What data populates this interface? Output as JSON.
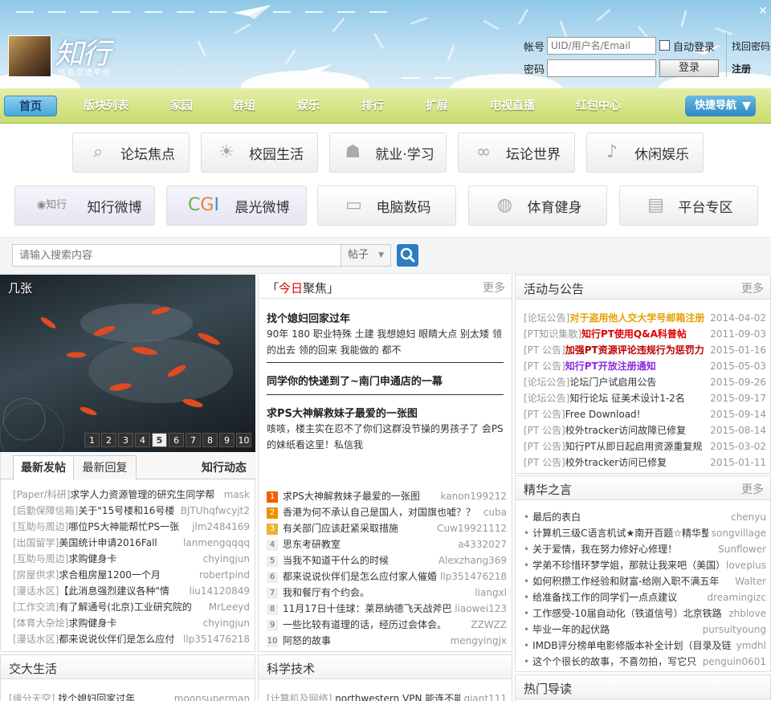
{
  "header": {
    "logo_brand": "知行",
    "logo_sub": "信息交流平台",
    "close_icon": "close-icon"
  },
  "login": {
    "account_label": "帐号",
    "account_placeholder": "UID/用户名/Email",
    "auto_login_label": "自动登录",
    "find_password": "找回密码",
    "password_label": "密码",
    "login_button": "登录",
    "register": "注册"
  },
  "nav": {
    "items": [
      "首页",
      "版块列表",
      "家园",
      "群组",
      "娱乐",
      "排行",
      "扩展",
      "电视直播",
      "红包中心"
    ],
    "quick_nav": "快捷导航"
  },
  "categories": {
    "row1": [
      {
        "label": "论坛焦点",
        "icon": "search-icon"
      },
      {
        "label": "校园生活",
        "icon": "bulb-icon"
      },
      {
        "label": "就业·学习",
        "icon": "people-icon"
      },
      {
        "label": "坛论世界",
        "icon": "binoculars-icon"
      },
      {
        "label": "休闲娱乐",
        "icon": "guitar-icon"
      }
    ],
    "row2": [
      {
        "label": "知行微博",
        "icon": "zhixing-logo-icon"
      },
      {
        "label": "晨光微博",
        "icon": "chenguang-logo-icon"
      },
      {
        "label": "电脑数码",
        "icon": "monitor-icon"
      },
      {
        "label": "体育健身",
        "icon": "ball-icon"
      },
      {
        "label": "平台专区",
        "icon": "board-icon"
      }
    ]
  },
  "search": {
    "placeholder": "请输入搜索内容",
    "type": "帖子"
  },
  "slideshow": {
    "title": "几张",
    "pages": [
      "1",
      "2",
      "3",
      "4",
      "5",
      "6",
      "7",
      "8",
      "9",
      "10"
    ],
    "active_page": "5"
  },
  "focus": {
    "title_prefix": "「",
    "title_red": "今日",
    "title_rest": "聚焦」",
    "more": "更多",
    "articles": [
      {
        "title": "找个媳妇回家过年",
        "summary": "90年 180 职业特殊 土建 我想媳妇 眼睛大点 别太矮 领的出去 领的回来 我能做的 都不"
      },
      {
        "title": "同学你的快递到了~南门申通店的一幕",
        "summary": ""
      },
      {
        "title": "求PS大神解救妹子最爱的一张图",
        "summary": "咳咳，楼主实在忍不了你们这群没节操的男孩子了 会PS的妹纸看这里！私信我"
      }
    ]
  },
  "activity": {
    "title": "活动与公告",
    "more": "更多",
    "items": [
      {
        "tag": "[论坛公告]",
        "text": "对于盗用他人交大学号邮箱注册",
        "date": "2014-04-02",
        "color": "#e8a000",
        "bold": true
      },
      {
        "tag": "[PT知识集散]",
        "text": "知行PT使用Q&A科普帖",
        "date": "2011-09-03",
        "color": "#e00000",
        "bold": true
      },
      {
        "tag": "[PT 公告]",
        "text": "加强PT资源评论违规行为惩罚力",
        "date": "2015-01-16",
        "color": "#c00000",
        "bold": true
      },
      {
        "tag": "[PT 公告]",
        "text": "知行PT开放注册通知",
        "date": "2015-05-03",
        "color": "#8a2be2",
        "bold": true
      },
      {
        "tag": "[论坛公告]",
        "text": "论坛门户试启用公告",
        "date": "2015-09-26",
        "color": "#333",
        "bold": false
      },
      {
        "tag": "[论坛公告]",
        "text": "知行论坛 征美术设计1-2名",
        "date": "2015-09-17",
        "color": "#333",
        "bold": false
      },
      {
        "tag": "[PT 公告]",
        "text": "Free Download!",
        "date": "2015-09-14",
        "color": "#333",
        "bold": false
      },
      {
        "tag": "[PT 公告]",
        "text": "校外tracker访问故障已修复",
        "date": "2015-08-14",
        "color": "#333",
        "bold": false
      },
      {
        "tag": "[PT 公告]",
        "text": "知行PT从即日起启用资源重复规",
        "date": "2015-03-02",
        "color": "#333",
        "bold": false
      },
      {
        "tag": "[PT 公告]",
        "text": "校外tracker访问已修复",
        "date": "2015-01-11",
        "color": "#333",
        "bold": false
      }
    ]
  },
  "posts": {
    "tabs": [
      "最新发帖",
      "最新回复"
    ],
    "side_title": "知行动态",
    "items": [
      {
        "tag": "[Paper/科研]",
        "text": "求学人力资源管理的研究生同学帮",
        "user": "mask"
      },
      {
        "tag": "[后勤保障信箱]",
        "text": "关于\"15号楼和16号楼",
        "user": "BJTUhqfwcyjt2"
      },
      {
        "tag": "[互助与周边]",
        "text": "哪位PS大神能帮忙PS一张",
        "user": "jlm2484169"
      },
      {
        "tag": "[出国留学]",
        "text": "美国统计申请2016Fall",
        "user": "lanmengqqqq"
      },
      {
        "tag": "[互助与周边]",
        "text": "求购健身卡",
        "user": "chyingjun"
      },
      {
        "tag": "[房屋供求]",
        "text": "求合租房屋1200一个月",
        "user": "robertpind"
      },
      {
        "tag": "[漫话水区]",
        "text": "【此消息强烈建议各种\"情",
        "user": "liu14120849"
      },
      {
        "tag": "[工作交流]",
        "text": "有了解通号(北京)工业研究院的",
        "user": "MrLeeyd"
      },
      {
        "tag": "[体育大杂烩]",
        "text": "求购健身卡",
        "user": "chyingjun"
      },
      {
        "tag": "[漫话水区]",
        "text": "都来说说伙伴们是怎么应付",
        "user": "llp351476218"
      }
    ]
  },
  "hot": {
    "items": [
      {
        "n": "1",
        "text": "求PS大神解救妹子最爱的一张图",
        "user": "kanon199212",
        "color": "#f06000"
      },
      {
        "n": "2",
        "text": "香港为何不承认自己是国人，对国旗也嘘？？",
        "user": "cuba",
        "color": "#f09000"
      },
      {
        "n": "3",
        "text": "有关部门应该赶紧采取措施",
        "user": "Cuw19921112",
        "color": "#f0b030"
      },
      {
        "n": "4",
        "text": "思东考研教室",
        "user": "a4332027",
        "color": "#ccc"
      },
      {
        "n": "5",
        "text": "当我不知道干什么的时候",
        "user": "Alexzhang369",
        "color": "#ccc"
      },
      {
        "n": "6",
        "text": "都来说说伙伴们是怎么应付家人催婚",
        "user": "llp351476218",
        "color": "#ccc"
      },
      {
        "n": "7",
        "text": "我和餐厅有个约会。",
        "user": "liangxl",
        "color": "#ccc"
      },
      {
        "n": "8",
        "text": "11月17日十佳球：莱昂纳德飞天战斧巴",
        "user": "liaowei123",
        "color": "#ccc"
      },
      {
        "n": "9",
        "text": "一些比较有道理的话，经历过会体会。",
        "user": "ZZWZZ",
        "color": "#ccc"
      },
      {
        "n": "10",
        "text": "阿怒的故事",
        "user": "mengyingjx",
        "color": "#ccc"
      }
    ]
  },
  "essence": {
    "title": "精华之言",
    "more": "更多",
    "items": [
      {
        "text": "最后的表白",
        "user": "chenyu"
      },
      {
        "text": "计算机三级C语言机试★南开百题☆精华整",
        "user": "songvillage"
      },
      {
        "text": "关于爱情，我在努力修好心修理！",
        "user": "Sunflower"
      },
      {
        "text": "学弟不珍惜环梦学姐，那就让我来吧（美国）",
        "user": "loveplus"
      },
      {
        "text": "如何积攒工作经验和财富-给刚入职不满五年",
        "user": "Walter"
      },
      {
        "text": "给准备找工作的同学们一点点建议",
        "user": "dreamingizc"
      },
      {
        "text": "工作感受-10届自动化（铁道信号）北京铁路",
        "user": "zhblove"
      },
      {
        "text": "毕业一年的起伏路",
        "user": "pursuityoung"
      },
      {
        "text": "IMDB评分榜单电影修版本补全计划（目录及链",
        "user": "ymdhl"
      },
      {
        "text": "这个个很长的故事，不喜勿拍，写它只",
        "user": "penguin0601"
      }
    ]
  },
  "bottom": {
    "campus_title": "交大生活",
    "campus_first_tag": "[缘分天空]",
    "campus_first_text": "找个媳妇回家过年",
    "campus_first_user": "moonsuperman",
    "tech_title": "科学技术",
    "tech_first_tag": "[计算机及网络]",
    "tech_first_text": "northwestern VPN 能连不能",
    "tech_first_user": "giant111",
    "hot_guide_title": "热门导读"
  }
}
